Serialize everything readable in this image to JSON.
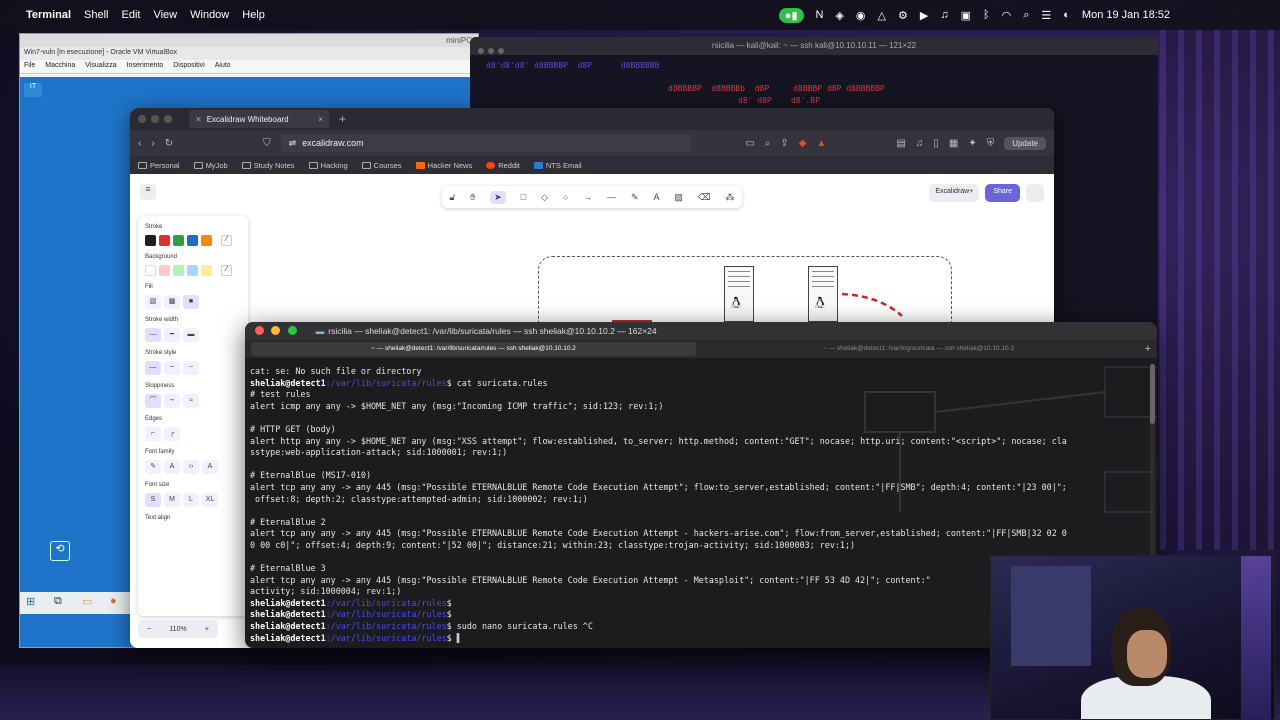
{
  "menubar": {
    "app": "Terminal",
    "items": [
      "Shell",
      "Edit",
      "View",
      "Window",
      "Help"
    ],
    "clock": "Mon 19 Jan  18:52"
  },
  "virtualbox": {
    "title": "Win7-vuln [In esecuzione] - Oracle VM VirtualBox",
    "host": "miniPC",
    "menu": [
      "File",
      "Macchina",
      "Visualizza",
      "Inserimento",
      "Dispositivi",
      "Aiuto"
    ],
    "desktop_icon_label": "IT"
  },
  "kali_terminal": {
    "title": "rsicilia — kali@kali: ~ — ssh kali@10.10.10.11 — 121×22",
    "banner_lines": [
      "d8'd8'd8' d8BBBBP  d8P      d8BBBBBB",
      "d8BBBBP  d8BBBBb  d8P     d8BBBP d8P d8BBBBBP",
      "d8' d8P    d8'.BP"
    ]
  },
  "browser": {
    "tab_title": "Excalidraw Whiteboard",
    "url": "excalidraw.com",
    "update_label": "Update",
    "bookmarks": [
      "Personal",
      "MyJob",
      "Study Notes",
      "Hacking",
      "Courses",
      "Hacker News",
      "Reddit",
      "NTS Email"
    ]
  },
  "excalidraw": {
    "library_label": "Excalidraw+",
    "share_label": "Share",
    "zoom": "110%",
    "sections": {
      "stroke": "Stroke",
      "background": "Background",
      "fill": "Fill",
      "stroke_width": "Stroke width",
      "stroke_style": "Stroke style",
      "sloppiness": "Sloppiness",
      "edges": "Edges",
      "font_family": "Font family",
      "font_size": "Font size",
      "text_align": "Text align"
    },
    "font_sizes": [
      "S",
      "M",
      "L",
      "XL"
    ],
    "stroke_colors": [
      "#1e1e1e",
      "#e03131",
      "#2f9e44",
      "#1971c2",
      "#f08c00"
    ],
    "background_colors": [
      "#ffffff",
      "#ffc9c9",
      "#b2f2bb",
      "#a5d8ff",
      "#ffec99"
    ]
  },
  "terminal": {
    "title": "rsicilia — sheliak@detect1: /var/lib/suricata/rules — ssh sheliak@10.10.10.2 — 162×24",
    "tabs": [
      "~ — sheliak@detect1: /var/lib/suricata/rules — ssh sheliak@10.10.10.2",
      "~ — sheliak@detect1: /var/log/suricata — ssh sheliak@10.10.10.2"
    ],
    "prompt_user": "sheliak@detect1",
    "prompt_path": ":/var/lib/suricata/rules",
    "lines": [
      {
        "kind": "text",
        "text": "cat: se: No such file or directory"
      },
      {
        "kind": "prompt",
        "cmd": "cat suricata.rules"
      },
      {
        "kind": "text",
        "text": "# test rules"
      },
      {
        "kind": "text",
        "text": "alert icmp any any -> $HOME_NET any (msg:\"Incoming ICMP traffic\"; sid:123; rev:1;)"
      },
      {
        "kind": "text",
        "text": ""
      },
      {
        "kind": "text",
        "text": "# HTTP GET (body)"
      },
      {
        "kind": "text",
        "text": "alert http any any -> $HOME_NET any (msg:\"XSS attempt\"; flow:established, to_server; http.method; content:\"GET\"; nocase; http.uri; content:\"<script>\"; nocase; cla"
      },
      {
        "kind": "text",
        "text": "sstype:web-application-attack; sid:1000001; rev:1;)"
      },
      {
        "kind": "text",
        "text": ""
      },
      {
        "kind": "text",
        "text": "# EternalBlue (MS17-010)"
      },
      {
        "kind": "text",
        "text": "alert tcp any any -> any 445 (msg:\"Possible ETERNALBLUE Remote Code Execution Attempt\"; flow:to_server,established; content:\"|FF|SMB\"; depth:4; content:\"|23 00|\";"
      },
      {
        "kind": "text",
        "text": " offset:8; depth:2; classtype:attempted-admin; sid:1000002; rev:1;)"
      },
      {
        "kind": "text",
        "text": ""
      },
      {
        "kind": "text",
        "text": "# EternalBlue 2"
      },
      {
        "kind": "text",
        "text": "alert tcp any any -> any 445 (msg:\"Possible ETERNALBLUE Remote Code Execution Attempt - hackers-arise.com\"; flow:from_server,established; content:\"|FF|SMB|32 02 0"
      },
      {
        "kind": "text",
        "text": "0 00 c0|\"; offset:4; depth:9; content:\"|52 00|\"; distance:21; within:23; classtype:trojan-activity; sid:1000003; rev:1;)"
      },
      {
        "kind": "text",
        "text": ""
      },
      {
        "kind": "text",
        "text": "# EternalBlue 3"
      },
      {
        "kind": "text",
        "text": "alert tcp any any -> any 445 (msg:\"Possible ETERNALBLUE Remote Code Execution Attempt - Metasploit\"; content:\"|FF 53 4D 42|\"; content:\""
      },
      {
        "kind": "text",
        "text": "activity; sid:1000004; rev:1;)"
      },
      {
        "kind": "prompt",
        "cmd": ""
      },
      {
        "kind": "prompt",
        "cmd": ""
      },
      {
        "kind": "prompt",
        "cmd": "sudo nano suricata.rules ^C"
      },
      {
        "kind": "prompt",
        "cmd": "",
        "cursor": true
      }
    ]
  }
}
